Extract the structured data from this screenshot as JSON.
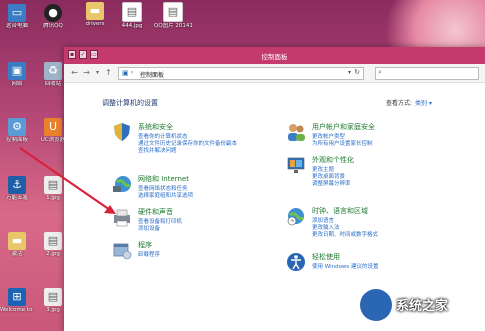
{
  "desktop": {
    "icons": [
      {
        "label": "这台电脑",
        "icon": "computer-icon"
      },
      {
        "label": "腾讯QQ",
        "icon": "qq-icon"
      },
      {
        "label": "网络",
        "icon": "network-icon"
      },
      {
        "label": "回收站",
        "icon": "recycle-bin-icon"
      },
      {
        "label": "控制面板",
        "icon": "control-panel-icon"
      },
      {
        "label": "UC浏览器",
        "icon": "uc-browser-icon"
      },
      {
        "label": "万能五笔",
        "icon": "wanneng-wubi-icon"
      },
      {
        "label": "1.jpg",
        "icon": "image-file-icon"
      },
      {
        "label": "激活",
        "icon": "folder-icon"
      },
      {
        "label": "2.jpg",
        "icon": "image-file-icon"
      },
      {
        "label": "Welcome to Tech Preview",
        "icon": "windows-icon"
      },
      {
        "label": "3.jpg",
        "icon": "image-file-icon"
      }
    ],
    "top_files": [
      {
        "label": "drivers",
        "icon": "folder-icon"
      },
      {
        "label": "444.jpg",
        "icon": "image-file-icon"
      },
      {
        "label": "QQ图片 20141009...",
        "icon": "image-file-icon"
      }
    ]
  },
  "window": {
    "title": "控制面板",
    "address": {
      "path": "控制面板",
      "separator": "›"
    },
    "search_placeholder": "",
    "heading": "调整计算机的设置",
    "view_by": {
      "label": "查看方式:",
      "value": "类别 ▾"
    },
    "categories_left": [
      {
        "title": "系统和安全",
        "links": [
          "查看你的计算机状态",
          "通过文件历史记录保存你的文件备份副本",
          "查找并解决问题"
        ],
        "icon": "shield-icon"
      },
      {
        "title": "网络和 Internet",
        "links": [
          "查看网络状态和任务",
          "选择家庭组和共享选项"
        ],
        "icon": "network-globe-icon"
      },
      {
        "title": "硬件和声音",
        "links": [
          "查看设备和打印机",
          "添加设备"
        ],
        "icon": "printer-icon"
      },
      {
        "title": "程序",
        "links": [
          "卸载程序"
        ],
        "icon": "programs-icon"
      }
    ],
    "categories_right": [
      {
        "title": "用户帐户和家庭安全",
        "links": [
          "更改帐户类型",
          "为所有用户设置家长控制"
        ],
        "icon": "users-icon"
      },
      {
        "title": "外观和个性化",
        "links": [
          "更改主题",
          "更改桌面背景",
          "调整屏幕分辨率"
        ],
        "icon": "appearance-icon"
      },
      {
        "title": "时钟、语言和区域",
        "links": [
          "添加语言",
          "更改输入法",
          "更改日期、时间或数字格式"
        ],
        "icon": "clock-globe-icon"
      },
      {
        "title": "轻松使用",
        "links": [
          "使用 Windows 建议的设置"
        ],
        "icon": "ease-of-access-icon"
      }
    ]
  },
  "watermark": {
    "text": "系统之家"
  },
  "colors": {
    "titlebar": "#c43a6d",
    "link": "#2a6dc7",
    "category_title": "#1d7a2f",
    "arrow": "#d8223a"
  }
}
